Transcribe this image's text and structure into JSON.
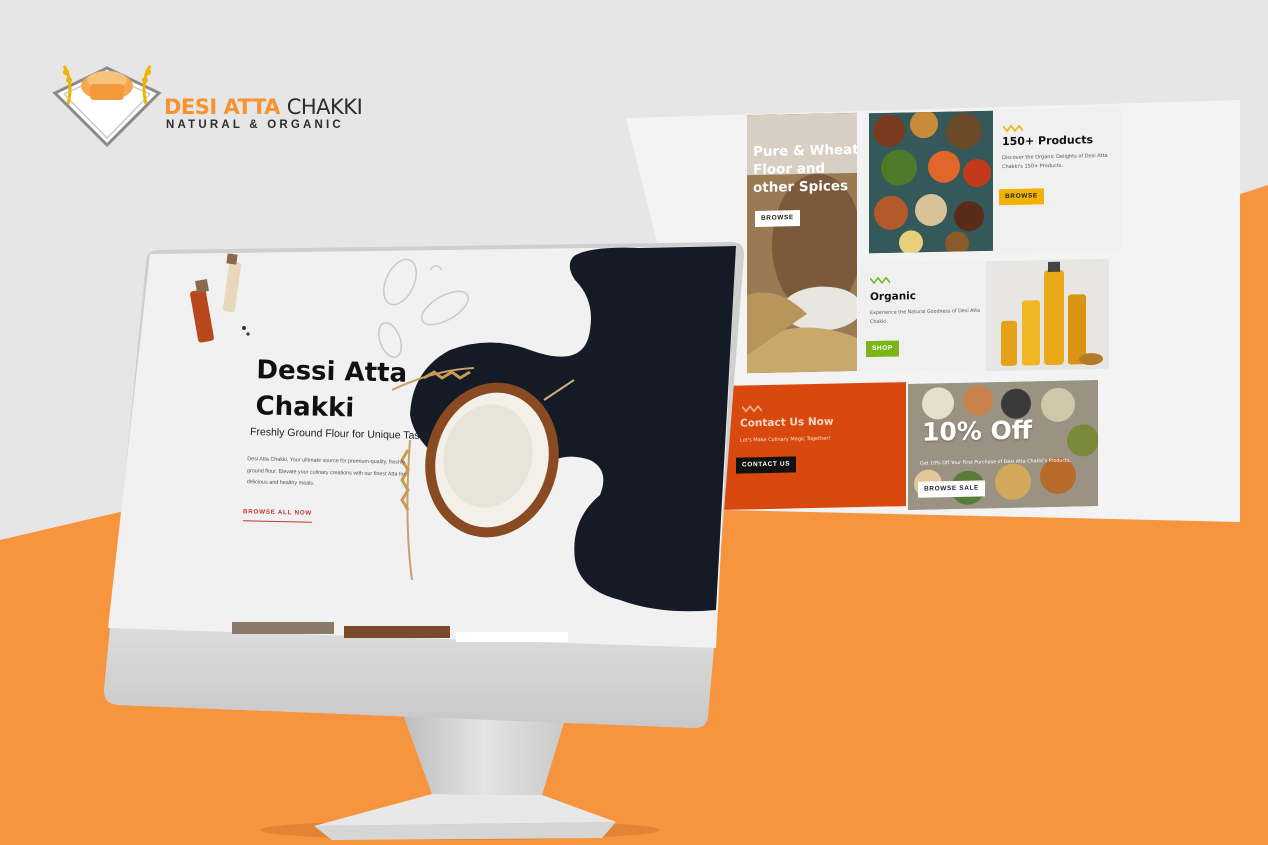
{
  "logo": {
    "brand_primary": "DESI ATTA",
    "brand_secondary": "CHAKKI",
    "tagline": "NATURAL & ORGANIC"
  },
  "colors": {
    "accent_orange": "#f7932e",
    "dark_navy": "#141a26",
    "tile_orange": "#d9480f",
    "yellow": "#f2b200",
    "green": "#7cb518",
    "cta_red": "#c0392b"
  },
  "back_site": {
    "tile_wheat": {
      "title_lines": [
        "Pure & Wheat",
        "Floor and",
        "other Spices"
      ],
      "button": "BROWSE"
    },
    "tile_products": {
      "title": "150+ Products",
      "desc_lines": [
        "Discover the Organic Delights of Desi Atta",
        "Chakki's 150+ Products."
      ],
      "button": "BROWSE"
    },
    "tile_organic": {
      "title": "Organic",
      "desc_lines": [
        "Experience the Natural Goodness of Desi Atta",
        "Chakki."
      ],
      "button": "SHOP"
    },
    "tile_contact": {
      "title": "Contact Us Now",
      "desc": "Let's Make Culinary Magic Together!",
      "button": "CONTACT US"
    },
    "tile_offer": {
      "title": "10% Off",
      "desc": "Get 10% Off Your First Purchase of Desi Atta Chakki's Products.",
      "button": "BROWSE SALE"
    }
  },
  "hero": {
    "title_line1": "Dessi Atta",
    "title_line2": "Chakki",
    "tagline": "Freshly Ground Flour for Unique Taste",
    "description": "Desi Atta Chakki, Your ultimate source for premium-quality, freshly ground flour. Elevate your culinary creations with our finest Atta for delicious and healthy meals.",
    "cta": "BROWSE ALL NOW"
  },
  "icons": [
    "wheat-logo-icon",
    "zigzag-icon",
    "flour-bowl-image",
    "wheat-stalk-icon",
    "spice-bottle-image",
    "seed-sketch-icon"
  ]
}
